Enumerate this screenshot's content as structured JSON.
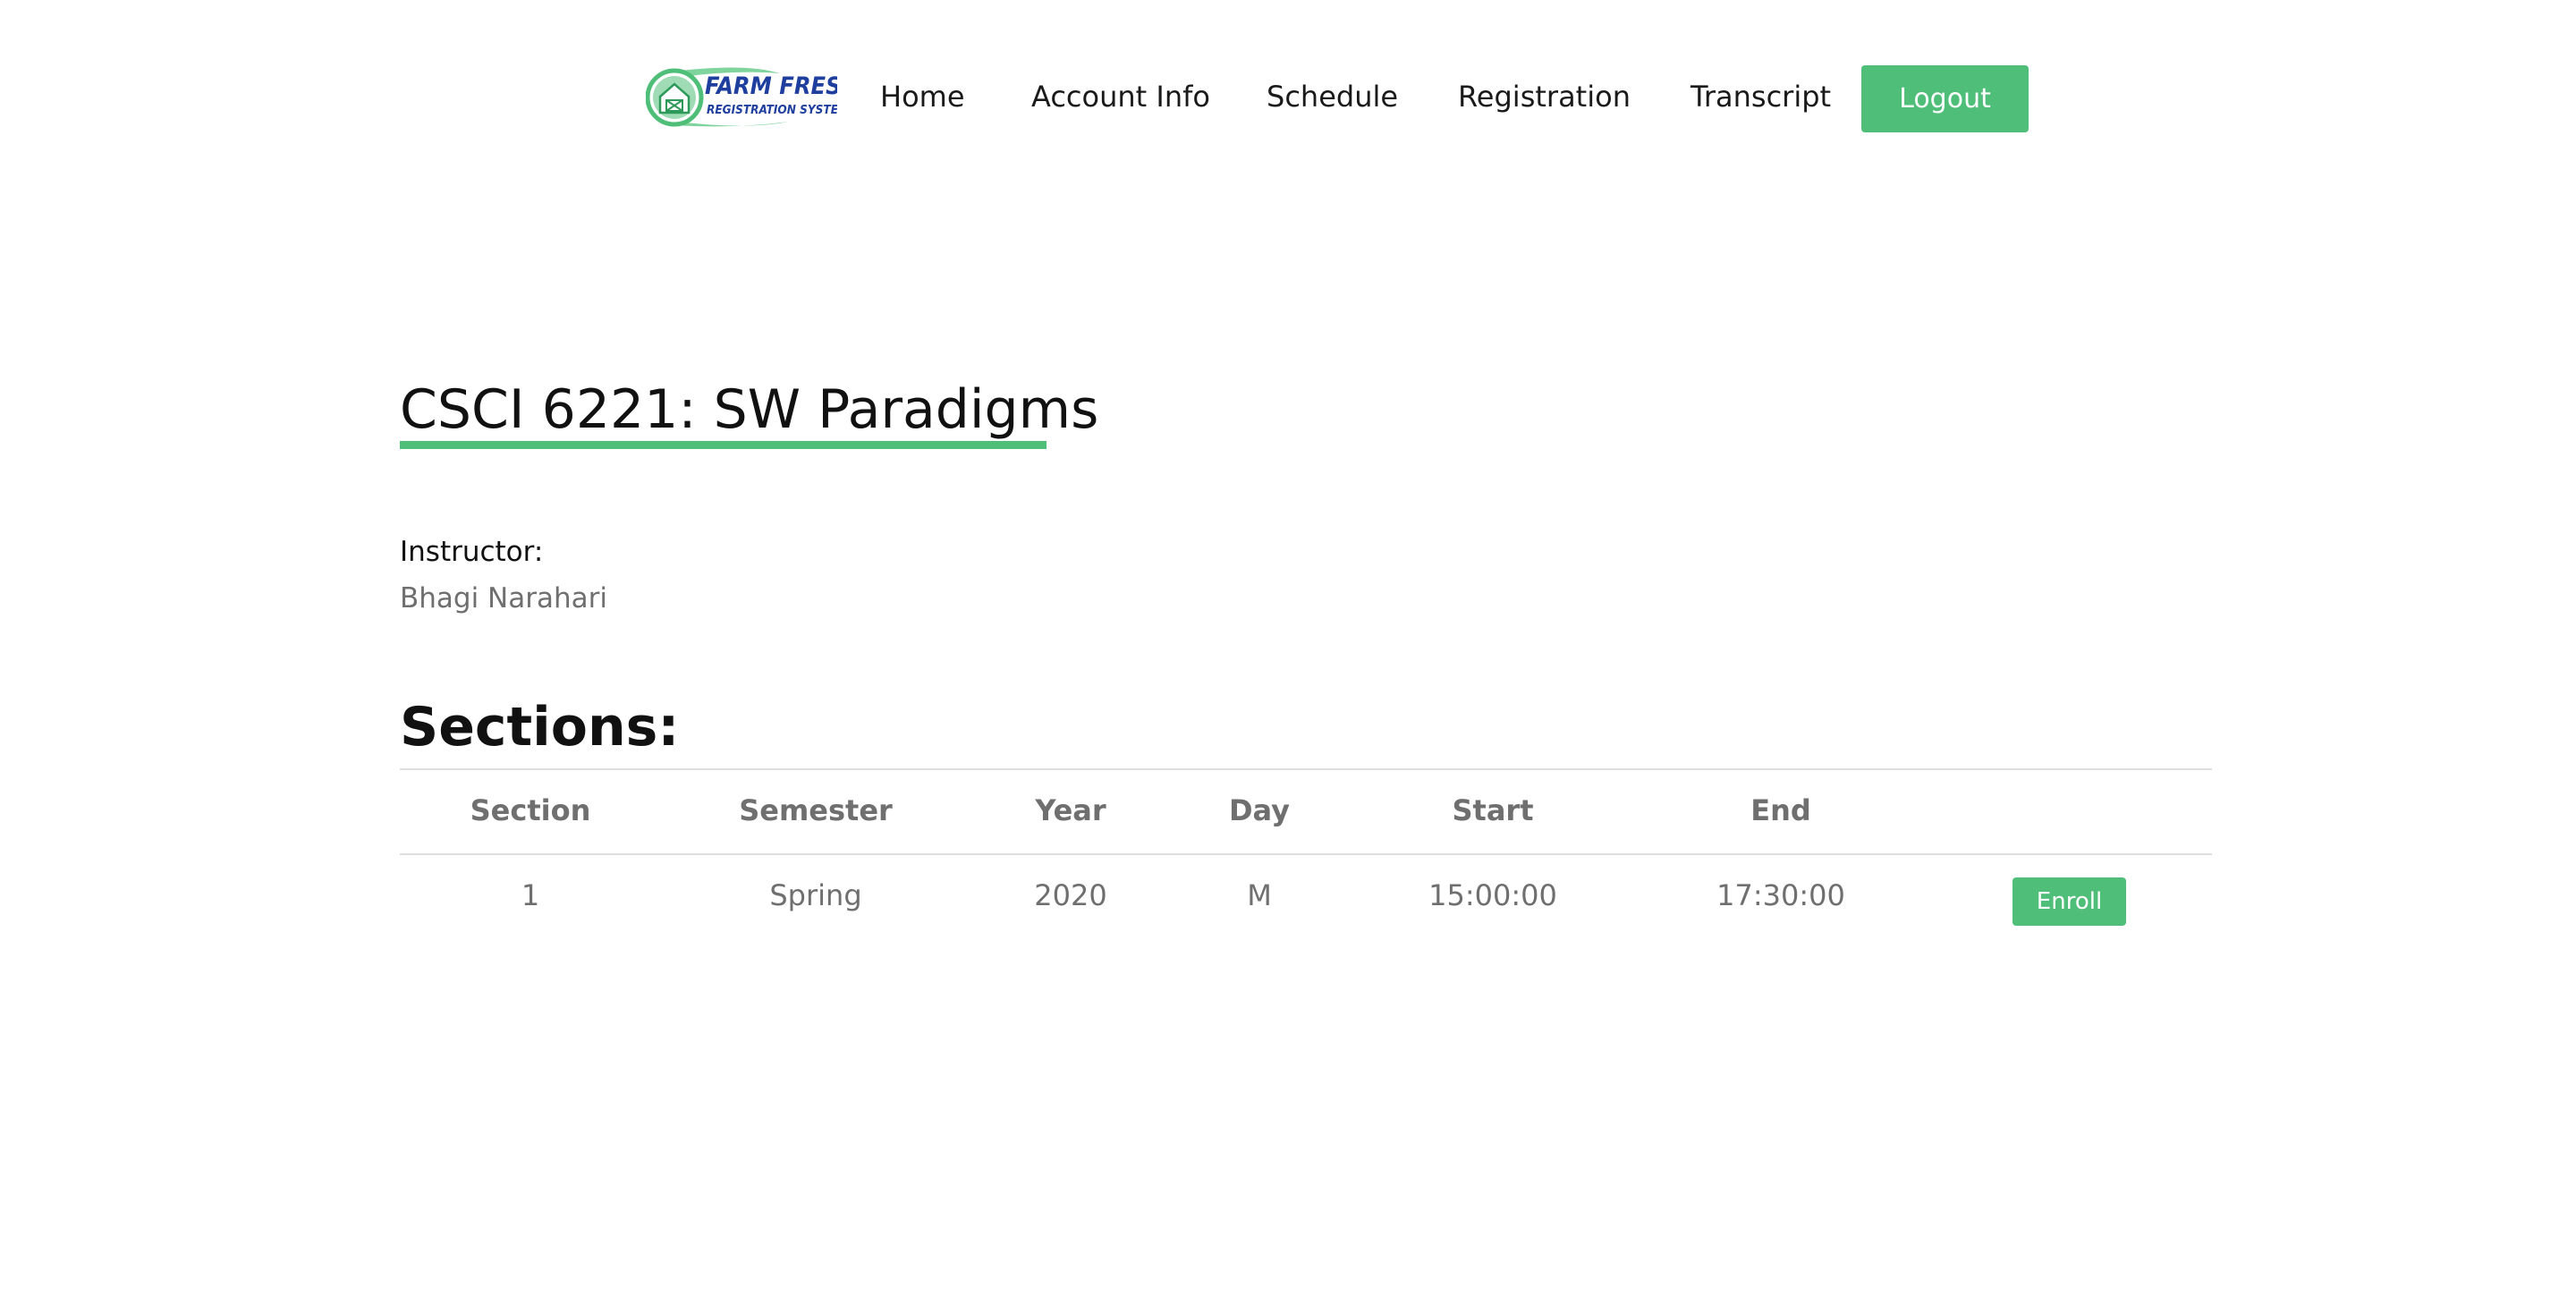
{
  "header": {
    "logo": {
      "line1": "FARM FRESH",
      "line2": "REGISTRATION SYSTEM",
      "icon": "barn-mailbox-icon"
    },
    "nav": {
      "home": "Home",
      "account_info": "Account Info",
      "schedule": "Schedule",
      "registration": "Registration",
      "transcript": "Transcript"
    },
    "logout_label": "Logout"
  },
  "course": {
    "title": "CSCI 6221: SW Paradigms",
    "instructor_label": "Instructor:",
    "instructor_name": "Bhagi Narahari"
  },
  "sections": {
    "heading": "Sections:",
    "columns": [
      "Section",
      "Semester",
      "Year",
      "Day",
      "Start",
      "End"
    ],
    "rows": [
      {
        "section": "1",
        "semester": "Spring",
        "year": "2020",
        "day": "M",
        "start": "15:00:00",
        "end": "17:30:00",
        "action_label": "Enroll"
      }
    ]
  },
  "colors": {
    "accent": "#4fbe78",
    "logo_blue": "#1f3f9e",
    "muted_text": "#6f6f6f"
  }
}
